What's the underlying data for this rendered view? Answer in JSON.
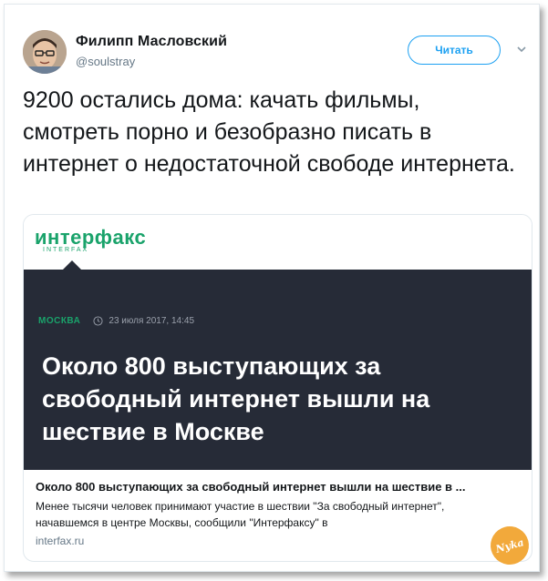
{
  "tweet": {
    "author": {
      "display_name": "Филипп Масловский",
      "handle": "@soulstray"
    },
    "follow_label": "Читать",
    "text": "9200 остались дома: качать фильмы, смотреть порно и безобразно писать в интернет о недостаточной свободе интернета."
  },
  "card": {
    "brand": {
      "main": "интерфакс",
      "sub": "INTERFAX"
    },
    "meta": {
      "city": "МОСКВА",
      "date": "23 июля 2017, 14:45"
    },
    "headline": "Около 800 выступающих за свободный интернет вышли на шествие в Москве",
    "title": "Около 800 выступающих за свободный интернет вышли на шествие в ...",
    "description": "Менее тысячи человек принимают участие в шествии \"За свободный интернет\", начавшемся в центре Москвы, сообщили \"Интерфаксу\" в",
    "domain": "interfax.ru"
  },
  "watermark": "Nyka",
  "icons": {
    "caret": "chevron-down-icon",
    "clock": "clock-icon"
  },
  "colors": {
    "accent": "#1da1f2",
    "brand_green": "#1aa36b",
    "panel_dark": "#262b37"
  }
}
